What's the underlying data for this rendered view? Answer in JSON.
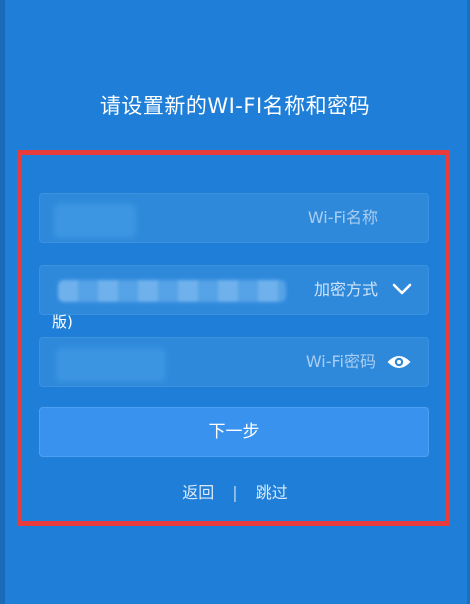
{
  "header": {
    "title": "请设置新的WI-FI名称和密码"
  },
  "form": {
    "wifi_name": {
      "placeholder": "Wi-Fi名称"
    },
    "encryption": {
      "selected_label": "加密方式",
      "overflow_text": "版)"
    },
    "wifi_password": {
      "placeholder": "Wi-Fi密码"
    },
    "next_button_label": "下一步"
  },
  "links": {
    "back_label": "返回",
    "separator": "|",
    "skip_label": "跳过"
  },
  "colors": {
    "background": "#1f7fd8",
    "field": "#2f89db",
    "button": "#3993ee",
    "highlight_frame": "#e83b3b",
    "text": "#ffffff"
  }
}
